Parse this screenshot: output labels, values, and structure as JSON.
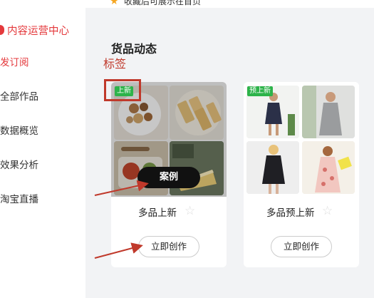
{
  "sidebar": {
    "brand": "内容运营中心",
    "items": [
      {
        "label": "发订阅",
        "active": true
      },
      {
        "label": "全部作品",
        "active": false
      },
      {
        "label": "数据概览",
        "active": false
      },
      {
        "label": "效果分析",
        "active": false
      },
      {
        "label": "淘宝直播",
        "active": false
      }
    ]
  },
  "notice": {
    "text": "收藏后可展示在首页"
  },
  "main": {
    "section_title": "货品动态",
    "annotation_label": "标签",
    "cards": [
      {
        "badge": "上新",
        "badge_color": "#2db34a",
        "overlay_button": "案例",
        "name": "多品上新",
        "favorite_icon": "star-outline-icon",
        "action_label": "立即创作",
        "thumbnails": [
          "nuts-bowl",
          "biscuits-plate",
          "food-tray",
          "cheesecake-slice"
        ]
      },
      {
        "badge": "预上新",
        "badge_color": "#2db34a",
        "name": "多品预上新",
        "favorite_icon": "star-outline-icon",
        "action_label": "立即创作",
        "thumbnails": [
          "woman-navy-dress",
          "woman-gray-dress",
          "woman-black-coat",
          "woman-floral-dress"
        ]
      }
    ]
  },
  "colors": {
    "accent": "#e4393c",
    "annotation": "#c0392b",
    "badge": "#2db34a",
    "page_bg": "#f2f3f5"
  }
}
